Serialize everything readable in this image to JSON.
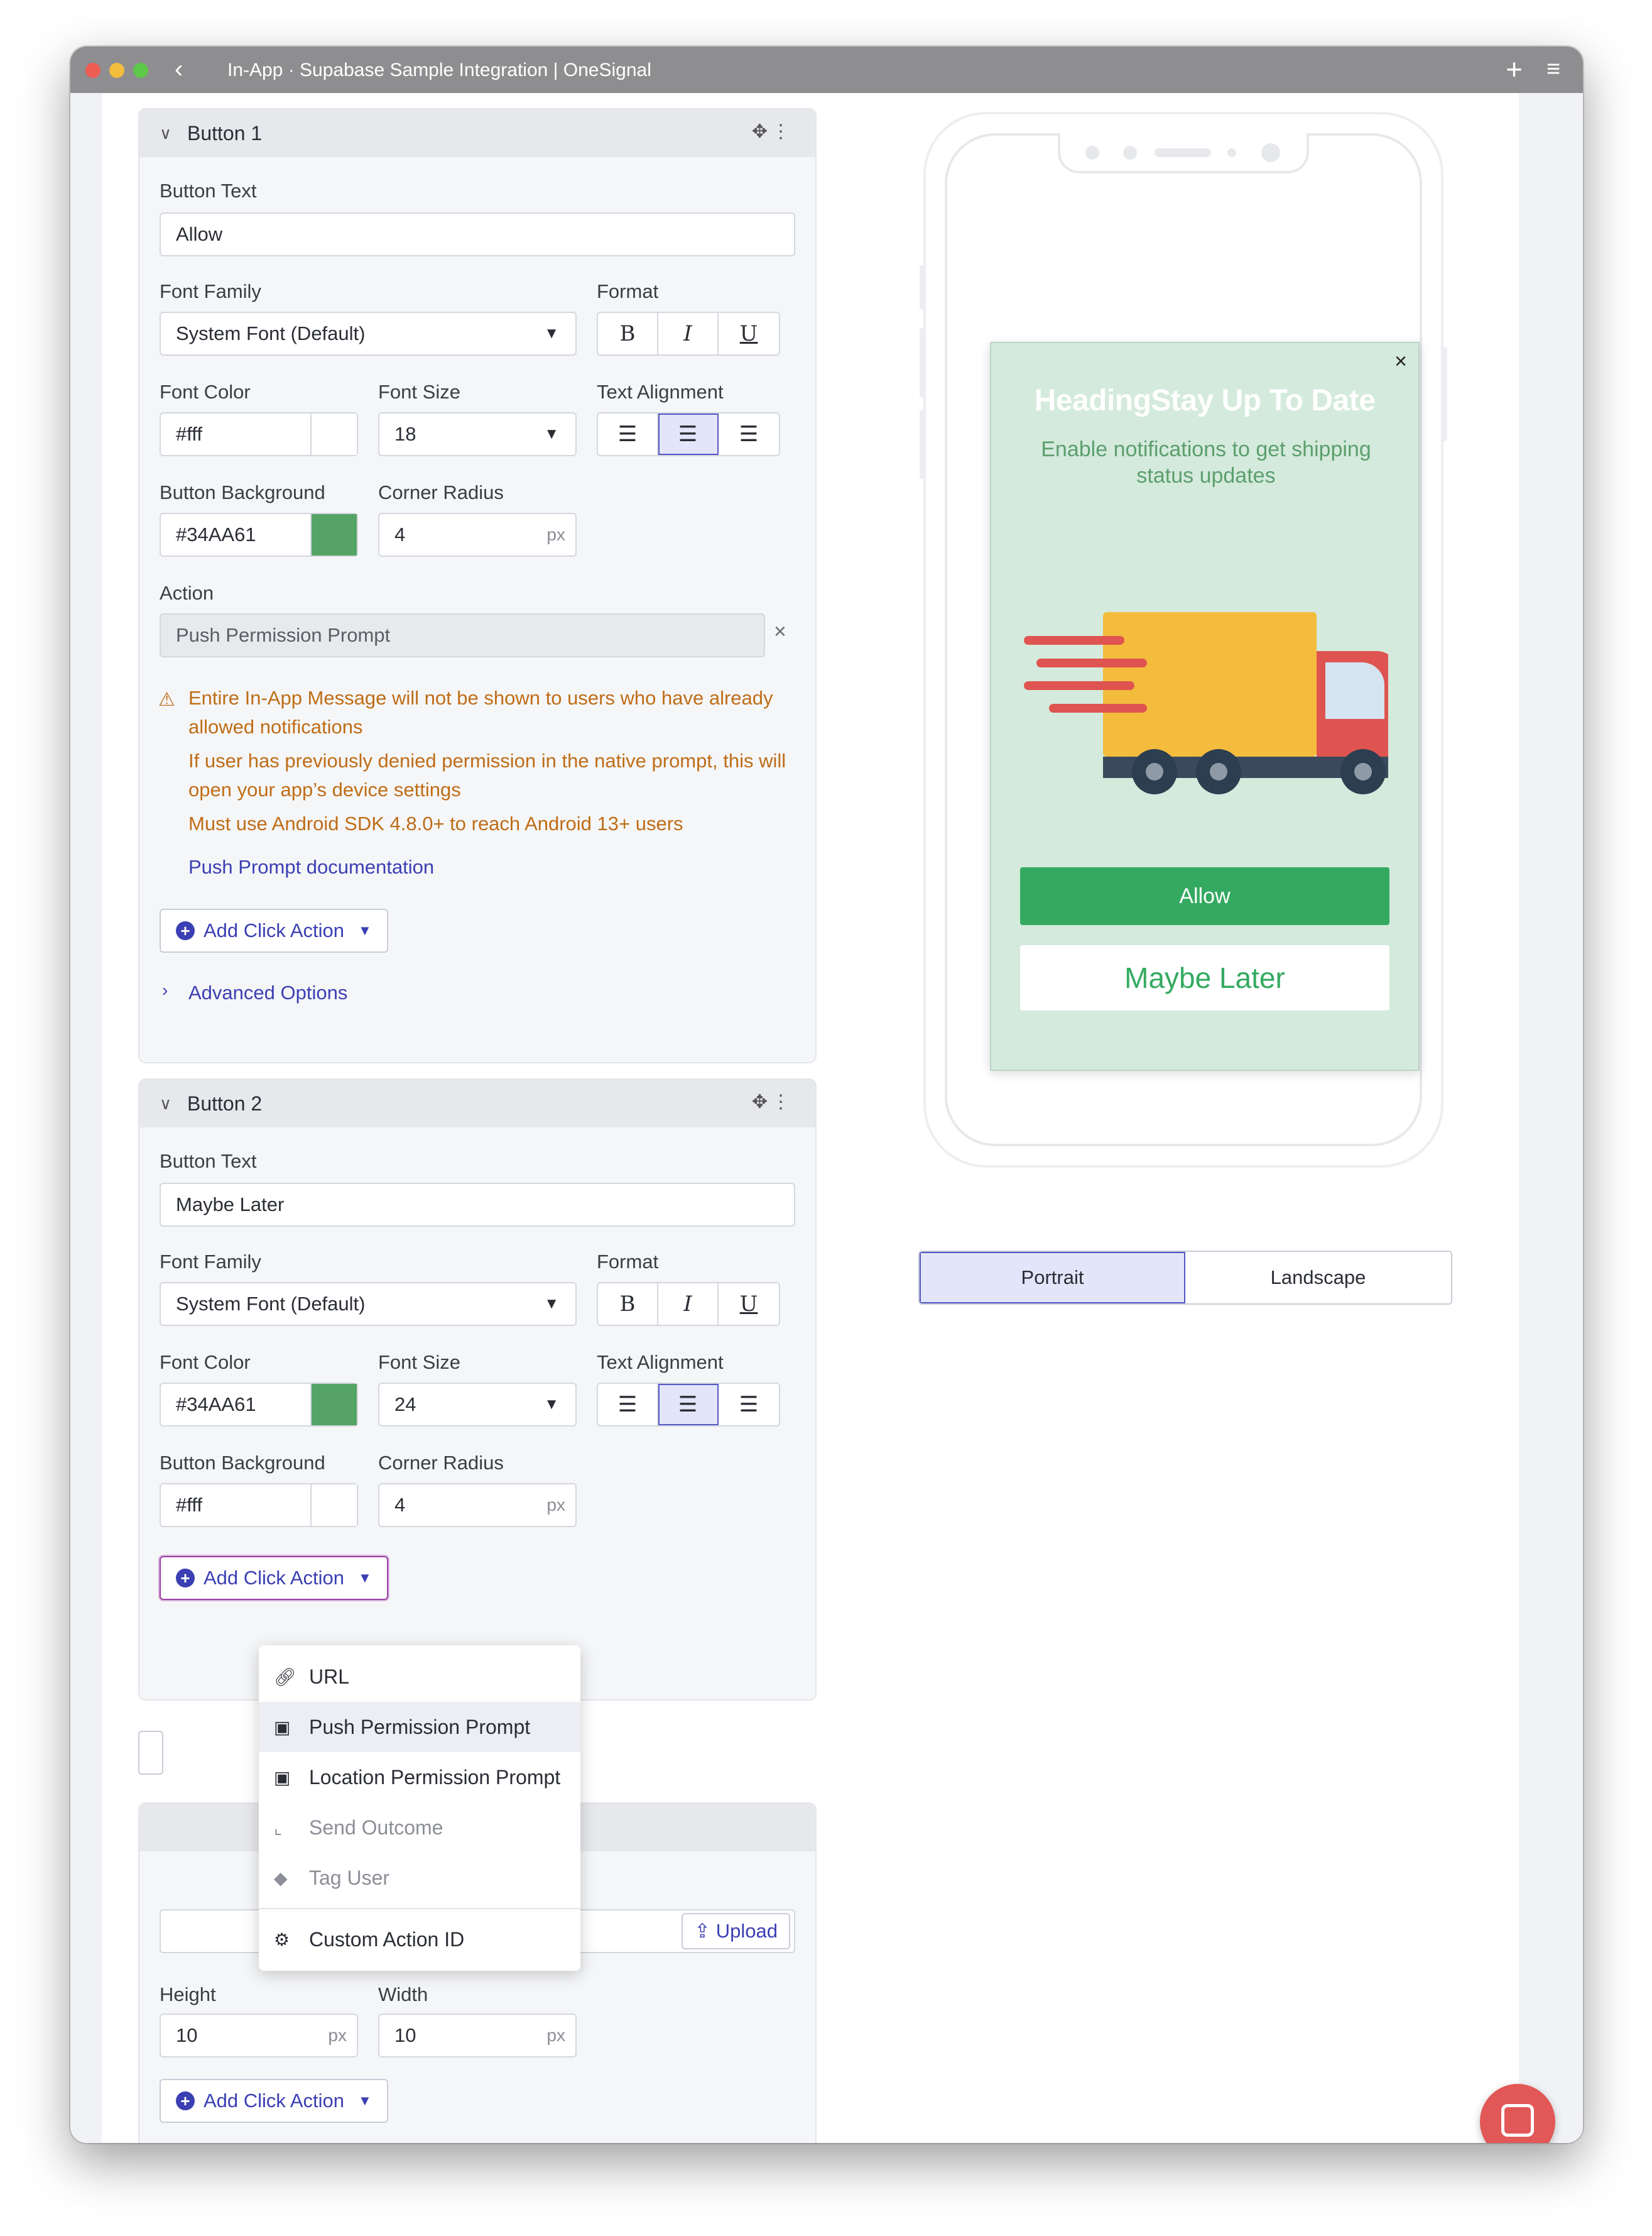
{
  "window": {
    "title": "In-App · Supabase Sample Integration | OneSignal",
    "back_icon": "chevron-left-icon",
    "new_tab_icon": "plus-icon",
    "menu_icon": "hamburger-icon"
  },
  "button1": {
    "header": "Button 1",
    "button_text_label": "Button Text",
    "button_text_value": "Allow",
    "font_family_label": "Font Family",
    "font_family_value": "System Font (Default)",
    "format_label": "Format",
    "font_color_label": "Font Color",
    "font_color_value": "#fff",
    "font_color_swatch": "#ffffff",
    "font_size_label": "Font Size",
    "font_size_value": "18",
    "text_alignment_label": "Text Alignment",
    "text_alignment_selected": "center",
    "button_background_label": "Button Background",
    "button_background_value": "#34AA61",
    "button_background_swatch": "#55a466",
    "corner_radius_label": "Corner Radius",
    "corner_radius_value": "4",
    "corner_radius_unit": "px",
    "action_label": "Action",
    "action_value": "Push Permission Prompt",
    "warning_1": "Entire In-App Message will not be shown to users who have already allowed notifications",
    "warning_2": "If user has previously denied permission in the native prompt, this will open your app’s device settings",
    "warning_3": "Must use Android SDK 4.8.0+ to reach Android 13+ users",
    "doc_link": "Push Prompt documentation",
    "add_click_action": "Add Click Action",
    "advanced_options": "Advanced Options"
  },
  "button2": {
    "header": "Button 2",
    "button_text_label": "Button Text",
    "button_text_value": "Maybe Later",
    "font_family_label": "Font Family",
    "font_family_value": "System Font (Default)",
    "format_label": "Format",
    "font_color_label": "Font Color",
    "font_color_value": "#34AA61",
    "font_color_swatch": "#55a466",
    "font_size_label": "Font Size",
    "font_size_value": "24",
    "text_alignment_label": "Text Alignment",
    "text_alignment_selected": "center",
    "button_background_label": "Button Background",
    "button_background_value": "#fff",
    "button_background_swatch": "#ffffff",
    "corner_radius_label": "Corner Radius",
    "corner_radius_value": "4",
    "corner_radius_unit": "px",
    "add_click_action": "Add Click Action"
  },
  "dropdown": {
    "items": [
      {
        "label": "URL",
        "icon": "link-icon"
      },
      {
        "label": "Push Permission Prompt",
        "icon": "phone-bell-icon"
      },
      {
        "label": "Location Permission Prompt",
        "icon": "phone-location-icon"
      },
      {
        "label": "Send Outcome",
        "icon": "chart-icon"
      },
      {
        "label": "Tag User",
        "icon": "tag-icon"
      },
      {
        "label": "Custom Action ID",
        "icon": "gear-icon"
      }
    ]
  },
  "image_block": {
    "upload_label": "Upload",
    "height_label": "Height",
    "height_value": "10",
    "width_label": "Width",
    "width_value": "10",
    "unit": "px",
    "add_click_action": "Add Click Action"
  },
  "preview": {
    "close": "×",
    "heading": "HeadingStay Up To Date",
    "body": "Enable notifications to get shipping status updates",
    "button1": "Allow",
    "button2": "Maybe Later",
    "background": "#d4eadc",
    "button1_color": "#34aa61"
  },
  "orientation": {
    "portrait": "Portrait",
    "landscape": "Landscape",
    "selected": "Portrait"
  },
  "format_buttons": {
    "bold": "B",
    "italic": "I",
    "underline": "U"
  }
}
